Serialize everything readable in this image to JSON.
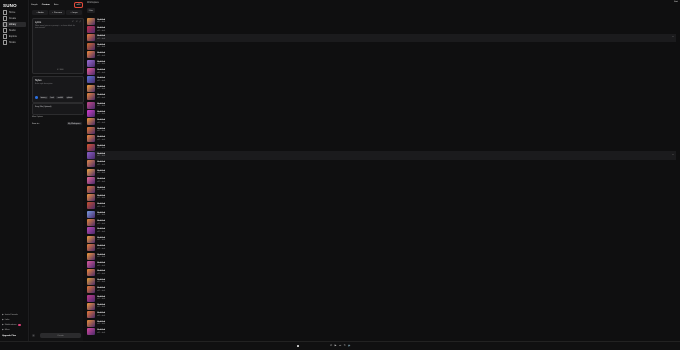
{
  "sidebar": {
    "logo": "SUNO",
    "nav": [
      {
        "label": "Home",
        "icon": "home-icon"
      },
      {
        "label": "Create",
        "icon": "plus-icon"
      },
      {
        "label": "Library",
        "icon": "library-icon"
      },
      {
        "label": "Studio",
        "icon": "studio-icon"
      },
      {
        "label": "Explore",
        "icon": "compass-icon"
      },
      {
        "label": "Hooks",
        "icon": "hooks-icon"
      },
      {
        "label": "Notifications",
        "icon": "bell-icon"
      }
    ],
    "bottom": [
      {
        "label": "Invite Friends",
        "icon": "gift-icon"
      },
      {
        "label": "Labs",
        "icon": "flask-icon"
      },
      {
        "label": "Notifications",
        "icon": "bell-icon",
        "badge": "2"
      },
      {
        "label": "More",
        "icon": "more-icon"
      }
    ],
    "upgrade": "Upgrade Plan"
  },
  "create": {
    "tabs": [
      "Simple",
      "Custom",
      "Beta"
    ],
    "version": "v4.5",
    "modes": [
      "+ Audio",
      "+ Persona",
      "+ Inspo"
    ],
    "lyrics_title": "Lyrics",
    "lyrics_placeholder": "Write some lyrics or a prompt — or leave blank for instrumental",
    "lyrics_footer": "0 / 3000",
    "style_title": "Styles",
    "style_placeholder": "Enter style description",
    "style_chips": [
      "bouncy",
      "funk",
      "soulful",
      "upbeat"
    ],
    "title_placeholder": "Song Title (Optional)",
    "advanced": "More Options",
    "save_to": "Save to...",
    "workspace": "My Workspace",
    "create_button": "Create"
  },
  "main": {
    "header": "Workspace",
    "right": "Sort",
    "filter": "Filter",
    "songs": [
      {
        "title": "Untitled",
        "sub": "v4.5 · draft",
        "color": "#e89a3c"
      },
      {
        "title": "Untitled",
        "sub": "v4.5 · draft",
        "color": "#c2314f"
      },
      {
        "title": "Untitled",
        "sub": "v4.5 · draft",
        "color": "#e67e3a"
      },
      {
        "title": "Untitled",
        "sub": "v4.5 · draft",
        "color": "#d06b2a"
      },
      {
        "title": "Untitled",
        "sub": "v4.5 · draft",
        "color": "#f08a3c"
      },
      {
        "title": "Untitled",
        "sub": "v4.5 · draft",
        "color": "#9a6fd6"
      },
      {
        "title": "Untitled",
        "sub": "v4.5 · draft",
        "color": "#e85f9a"
      },
      {
        "title": "Untitled",
        "sub": "v4.5 · draft",
        "color": "#5a78d8"
      },
      {
        "title": "Untitled",
        "sub": "v4.5 · draft",
        "color": "#f2a23a"
      },
      {
        "title": "Untitled",
        "sub": "v4.5 · draft",
        "color": "#e8883a"
      },
      {
        "title": "Untitled",
        "sub": "v4.5 · draft",
        "color": "#c24a8a"
      },
      {
        "title": "Untitled",
        "sub": "v4.5 · draft",
        "color": "#d43fd0"
      },
      {
        "title": "Untitled",
        "sub": "v4.5 · draft",
        "color": "#f09a3a"
      },
      {
        "title": "Untitled",
        "sub": "v4.5 · draft",
        "color": "#e07a30"
      },
      {
        "title": "Untitled",
        "sub": "v4.5 · draft",
        "color": "#ef8c3d"
      },
      {
        "title": "Untitled",
        "sub": "v4.5 · draft",
        "color": "#d8542e"
      },
      {
        "title": "Untitled",
        "sub": "v4.5 · draft",
        "color": "#8a5fc8"
      },
      {
        "title": "Untitled",
        "sub": "v4.5 · draft",
        "color": "#e0884a"
      },
      {
        "title": "Untitled",
        "sub": "v4.5 · draft",
        "color": "#f2a642"
      },
      {
        "title": "Untitled",
        "sub": "v4.5 · draft",
        "color": "#e86a9a"
      },
      {
        "title": "Untitled",
        "sub": "v4.5 · draft",
        "color": "#d8783a"
      },
      {
        "title": "Untitled",
        "sub": "v4.5 · draft",
        "color": "#f0963e"
      },
      {
        "title": "Untitled",
        "sub": "v4.5 · draft",
        "color": "#c8502e"
      },
      {
        "title": "Untitled",
        "sub": "v4.5 · draft",
        "color": "#7a9ae0"
      },
      {
        "title": "Untitled",
        "sub": "v4.5 · draft",
        "color": "#e4883a"
      },
      {
        "title": "Untitled",
        "sub": "v4.5 · draft",
        "color": "#b94ab8"
      },
      {
        "title": "Untitled",
        "sub": "v4.5 · draft",
        "color": "#f0a03f"
      },
      {
        "title": "Untitled",
        "sub": "v4.5 · draft",
        "color": "#e6803a"
      },
      {
        "title": "Untitled",
        "sub": "v4.5 · draft",
        "color": "#f29a3a"
      },
      {
        "title": "Untitled",
        "sub": "v4.5 · draft",
        "color": "#d95a9e"
      },
      {
        "title": "Untitled",
        "sub": "v4.5 · draft",
        "color": "#ef8a3a"
      },
      {
        "title": "Untitled",
        "sub": "v4.5 · draft",
        "color": "#e4a03a"
      },
      {
        "title": "Untitled",
        "sub": "v4.5 · draft",
        "color": "#e27a35"
      },
      {
        "title": "Untitled",
        "sub": "v4.5 · draft",
        "color": "#c13a8c"
      },
      {
        "title": "Untitled",
        "sub": "v4.5 · draft",
        "color": "#f0983e"
      },
      {
        "title": "Untitled",
        "sub": "v4.5 · draft",
        "color": "#e87a38"
      },
      {
        "title": "Untitled",
        "sub": "v4.5 · draft",
        "color": "#e88f3a"
      },
      {
        "title": "Untitled",
        "sub": "v4.5 · draft",
        "color": "#d64aa0"
      }
    ]
  },
  "player": {
    "controls": [
      "prev-icon",
      "play-icon",
      "next-icon",
      "repeat-icon",
      "volume-icon"
    ]
  }
}
